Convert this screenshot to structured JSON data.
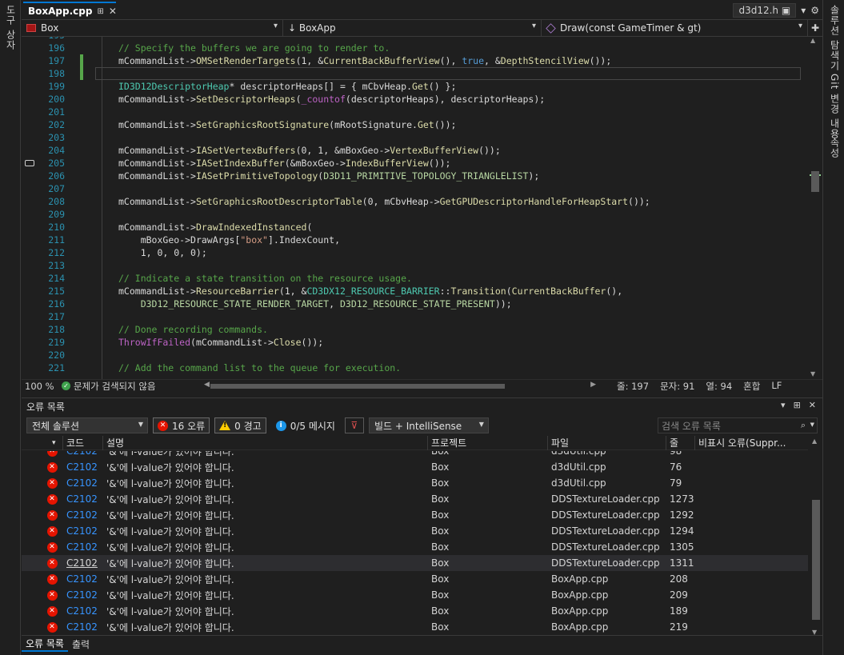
{
  "left_strip": {
    "label": "도구 상자"
  },
  "right_strip": {
    "items": [
      "솔루션 탐색기",
      "Git 변경 내용",
      "속성"
    ]
  },
  "tabbar": {
    "active_tab": "BoxApp.cpp",
    "preview_file": "d3d12.h",
    "preview_pin": "▣",
    "pin_glyph": "⊞",
    "close_glyph": "✕",
    "dropdown_glyph": "▾",
    "settings_glyph": "⚙"
  },
  "navbar": {
    "project": "Box",
    "class_scope": "↓ BoxApp",
    "member": "Draw(const GameTimer & gt)",
    "split_glyph": "✚"
  },
  "editor": {
    "current_line": 197,
    "lines": [
      {
        "n": "195",
        "tokens": []
      },
      {
        "n": "196",
        "tokens": [
          [
            "c",
            "// Specify the buffers we are going to render to."
          ]
        ]
      },
      {
        "n": "197",
        "tokens": [
          [
            "v",
            "mCommandList"
          ],
          [
            "p",
            "->"
          ],
          [
            "f",
            "OMSetRenderTargets"
          ],
          [
            "p",
            "(1, &"
          ],
          [
            "f",
            "CurrentBackBufferView"
          ],
          [
            "p",
            "(), "
          ],
          [
            "k",
            "true"
          ],
          [
            "p",
            ", &"
          ],
          [
            "f",
            "DepthStencilView"
          ],
          [
            "p",
            "());"
          ]
        ]
      },
      {
        "n": "198",
        "tokens": []
      },
      {
        "n": "199",
        "tokens": [
          [
            "t",
            "ID3D12DescriptorHeap"
          ],
          [
            "p",
            "* "
          ],
          [
            "v",
            "descriptorHeaps"
          ],
          [
            "p",
            "[] = { "
          ],
          [
            "v",
            "mCbvHeap"
          ],
          [
            "p",
            "."
          ],
          [
            "f",
            "Get"
          ],
          [
            "p",
            "() };"
          ]
        ]
      },
      {
        "n": "200",
        "tokens": [
          [
            "v",
            "mCommandList"
          ],
          [
            "p",
            "->"
          ],
          [
            "f",
            "SetDescriptorHeaps"
          ],
          [
            "p",
            "("
          ],
          [
            "m",
            "_countof"
          ],
          [
            "p",
            "("
          ],
          [
            "v",
            "descriptorHeaps"
          ],
          [
            "p",
            "), "
          ],
          [
            "v",
            "descriptorHeaps"
          ],
          [
            "p",
            ");"
          ]
        ]
      },
      {
        "n": "201",
        "tokens": []
      },
      {
        "n": "202",
        "tokens": [
          [
            "v",
            "mCommandList"
          ],
          [
            "p",
            "->"
          ],
          [
            "f",
            "SetGraphicsRootSignature"
          ],
          [
            "p",
            "("
          ],
          [
            "v",
            "mRootSignature"
          ],
          [
            "p",
            "."
          ],
          [
            "f",
            "Get"
          ],
          [
            "p",
            "());"
          ]
        ]
      },
      {
        "n": "203",
        "tokens": []
      },
      {
        "n": "204",
        "tokens": [
          [
            "v",
            "mCommandList"
          ],
          [
            "p",
            "->"
          ],
          [
            "f",
            "IASetVertexBuffers"
          ],
          [
            "p",
            "(0, 1, &"
          ],
          [
            "v",
            "mBoxGeo"
          ],
          [
            "p",
            "->"
          ],
          [
            "f",
            "VertexBufferView"
          ],
          [
            "p",
            "());"
          ]
        ]
      },
      {
        "n": "205",
        "tokens": [
          [
            "v",
            "mCommandList"
          ],
          [
            "p",
            "->"
          ],
          [
            "f",
            "IASetIndexBuffer"
          ],
          [
            "p",
            "(&"
          ],
          [
            "v",
            "mBoxGeo"
          ],
          [
            "p",
            "->"
          ],
          [
            "f",
            "IndexBufferView"
          ],
          [
            "p",
            "());"
          ]
        ]
      },
      {
        "n": "206",
        "tokens": [
          [
            "v",
            "mCommandList"
          ],
          [
            "p",
            "->"
          ],
          [
            "f",
            "IASetPrimitiveTopology"
          ],
          [
            "p",
            "("
          ],
          [
            "e",
            "D3D11_PRIMITIVE_TOPOLOGY_TRIANGLELIST"
          ],
          [
            "p",
            ");"
          ]
        ]
      },
      {
        "n": "207",
        "tokens": []
      },
      {
        "n": "208",
        "tokens": [
          [
            "v",
            "mCommandList"
          ],
          [
            "p",
            "->"
          ],
          [
            "f",
            "SetGraphicsRootDescriptorTable"
          ],
          [
            "p",
            "(0, "
          ],
          [
            "v",
            "mCbvHeap"
          ],
          [
            "p",
            "->"
          ],
          [
            "f",
            "GetGPUDescriptorHandleForHeapStart"
          ],
          [
            "p",
            "());"
          ]
        ]
      },
      {
        "n": "209",
        "tokens": []
      },
      {
        "n": "210",
        "tokens": [
          [
            "v",
            "mCommandList"
          ],
          [
            "p",
            "->"
          ],
          [
            "f",
            "DrawIndexedInstanced"
          ],
          [
            "p",
            "("
          ]
        ]
      },
      {
        "n": "211",
        "tokens": [
          [
            "p",
            "    "
          ],
          [
            "v",
            "mBoxGeo"
          ],
          [
            "p",
            "->"
          ],
          [
            "v",
            "DrawArgs"
          ],
          [
            "p",
            "["
          ],
          [
            "s",
            "\"box\""
          ],
          [
            "p",
            "]."
          ],
          [
            "v",
            "IndexCount"
          ],
          [
            "p",
            ","
          ]
        ]
      },
      {
        "n": "212",
        "tokens": [
          [
            "p",
            "    1, 0, 0, 0);"
          ]
        ]
      },
      {
        "n": "213",
        "tokens": []
      },
      {
        "n": "214",
        "tokens": [
          [
            "c",
            "// Indicate a state transition on the resource usage."
          ]
        ]
      },
      {
        "n": "215",
        "tokens": [
          [
            "v",
            "mCommandList"
          ],
          [
            "p",
            "->"
          ],
          [
            "f",
            "ResourceBarrier"
          ],
          [
            "p",
            "(1, &"
          ],
          [
            "t",
            "CD3DX12_RESOURCE_BARRIER"
          ],
          [
            "p",
            "::"
          ],
          [
            "f",
            "Transition"
          ],
          [
            "p",
            "("
          ],
          [
            "f",
            "CurrentBackBuffer"
          ],
          [
            "p",
            "(),"
          ]
        ]
      },
      {
        "n": "216",
        "tokens": [
          [
            "p",
            "    "
          ],
          [
            "e",
            "D3D12_RESOURCE_STATE_RENDER_TARGET"
          ],
          [
            "p",
            ", "
          ],
          [
            "e",
            "D3D12_RESOURCE_STATE_PRESENT"
          ],
          [
            "p",
            "));"
          ]
        ]
      },
      {
        "n": "217",
        "tokens": []
      },
      {
        "n": "218",
        "tokens": [
          [
            "c",
            "// Done recording commands."
          ]
        ]
      },
      {
        "n": "219",
        "tokens": [
          [
            "m",
            "ThrowIfFailed"
          ],
          [
            "p",
            "("
          ],
          [
            "v",
            "mCommandList"
          ],
          [
            "p",
            "->"
          ],
          [
            "f",
            "Close"
          ],
          [
            "p",
            "());"
          ]
        ]
      },
      {
        "n": "220",
        "tokens": []
      },
      {
        "n": "221",
        "tokens": [
          [
            "c",
            "// Add the command list to the queue for execution."
          ]
        ]
      }
    ]
  },
  "status": {
    "zoom": "100 %",
    "issues": "문제가 검색되지 않음",
    "line": "줄: 197",
    "char": "문자: 91",
    "col": "열: 94",
    "indent": "혼합",
    "eol": "LF"
  },
  "errorlist": {
    "title": "오류 목록",
    "ctrl_dropdown": "▾",
    "ctrl_pin": "⊞",
    "ctrl_close": "✕",
    "scope": "전체 솔루션",
    "errors_filter": "16 오류",
    "warnings_filter": "0 경고",
    "messages_filter": "0/5 메시지",
    "build_filter": "빌드 + IntelliSense",
    "search_placeholder": "검색 오류 목록",
    "columns": {
      "code": "코드",
      "desc": "설명",
      "project": "프로젝트",
      "file": "파일",
      "line": "줄",
      "suppression": "비표시 오류(Suppr..."
    },
    "rows": [
      {
        "code": "C2102",
        "desc": "'&'에 l-value가 있어야 합니다.",
        "project": "Box",
        "file": "d3dUtil.cpp",
        "line": "98",
        "partial": true
      },
      {
        "code": "C2102",
        "desc": "'&'에 l-value가 있어야 합니다.",
        "project": "Box",
        "file": "d3dUtil.cpp",
        "line": "76"
      },
      {
        "code": "C2102",
        "desc": "'&'에 l-value가 있어야 합니다.",
        "project": "Box",
        "file": "d3dUtil.cpp",
        "line": "79"
      },
      {
        "code": "C2102",
        "desc": "'&'에 l-value가 있어야 합니다.",
        "project": "Box",
        "file": "DDSTextureLoader.cpp",
        "line": "1273"
      },
      {
        "code": "C2102",
        "desc": "'&'에 l-value가 있어야 합니다.",
        "project": "Box",
        "file": "DDSTextureLoader.cpp",
        "line": "1292"
      },
      {
        "code": "C2102",
        "desc": "'&'에 l-value가 있어야 합니다.",
        "project": "Box",
        "file": "DDSTextureLoader.cpp",
        "line": "1294"
      },
      {
        "code": "C2102",
        "desc": "'&'에 l-value가 있어야 합니다.",
        "project": "Box",
        "file": "DDSTextureLoader.cpp",
        "line": "1305"
      },
      {
        "code": "C2102",
        "desc": "'&'에 l-value가 있어야 합니다.",
        "project": "Box",
        "file": "DDSTextureLoader.cpp",
        "line": "1311",
        "selected": true
      },
      {
        "code": "C2102",
        "desc": "'&'에 l-value가 있어야 합니다.",
        "project": "Box",
        "file": "BoxApp.cpp",
        "line": "208"
      },
      {
        "code": "C2102",
        "desc": "'&'에 l-value가 있어야 합니다.",
        "project": "Box",
        "file": "BoxApp.cpp",
        "line": "209"
      },
      {
        "code": "C2102",
        "desc": "'&'에 l-value가 있어야 합니다.",
        "project": "Box",
        "file": "BoxApp.cpp",
        "line": "189"
      },
      {
        "code": "C2102",
        "desc": "'&'에 l-value가 있어야 합니다.",
        "project": "Box",
        "file": "BoxApp.cpp",
        "line": "219"
      }
    ]
  },
  "bottom_tabs": {
    "errors": "오류 목록",
    "output": "출력"
  },
  "colors": {
    "accent": "#0078d4",
    "error": "#e51400",
    "warning": "#ffcc00",
    "info": "#1c97ea",
    "ok": "#3fa34d",
    "change_bar": "#57a64a"
  }
}
